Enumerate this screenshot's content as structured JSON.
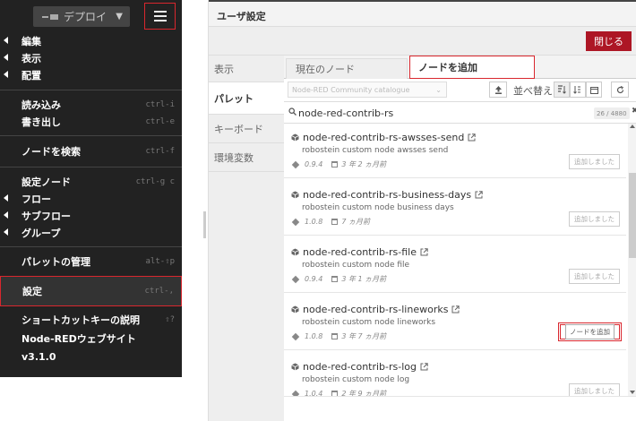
{
  "menu": {
    "deploy_label": "デプロイ",
    "items": [
      {
        "label": "編集",
        "shortcut": "",
        "caret": true
      },
      {
        "label": "表示",
        "shortcut": "",
        "caret": true
      },
      {
        "label": "配置",
        "shortcut": "",
        "caret": true
      },
      {
        "label": "読み込み",
        "shortcut": "ctrl-i",
        "caret": false
      },
      {
        "label": "書き出し",
        "shortcut": "ctrl-e",
        "caret": false
      },
      {
        "label": "ノードを検索",
        "shortcut": "ctrl-f",
        "caret": false
      },
      {
        "label": "設定ノード",
        "shortcut": "ctrl-g c",
        "caret": false
      },
      {
        "label": "フロー",
        "shortcut": "",
        "caret": true
      },
      {
        "label": "サブフロー",
        "shortcut": "",
        "caret": true
      },
      {
        "label": "グループ",
        "shortcut": "",
        "caret": true
      },
      {
        "label": "パレットの管理",
        "shortcut": "alt-⇧p",
        "caret": false
      },
      {
        "label": "設定",
        "shortcut": "ctrl-,",
        "caret": false
      },
      {
        "label": "ショートカットキーの説明",
        "shortcut": "⇧?",
        "caret": false
      },
      {
        "label": "Node-REDウェブサイト",
        "shortcut": "",
        "caret": false
      },
      {
        "label": "v3.1.0",
        "shortcut": "",
        "caret": false
      }
    ]
  },
  "dialog": {
    "title": "ユーザ設定",
    "close_label": "閉じる",
    "side_tabs": [
      "表示",
      "パレット",
      "キーボード",
      "環境変数"
    ],
    "sub_tabs": [
      "現在のノード",
      "ノードを追加"
    ],
    "catalogue": "Node-RED Community catalogue",
    "sort_label": "並べ替え:",
    "search_value": "node-red-contrib-rs",
    "count": "26 / 4880",
    "nodes": [
      {
        "name": "node-red-contrib-rs-awsses-send",
        "desc": "robostein custom node awsses send",
        "version": "0.9.4",
        "updated": "3 年 2 ヵ月前",
        "button": "追加しました",
        "installed": true
      },
      {
        "name": "node-red-contrib-rs-business-days",
        "desc": "robostein custom node business days",
        "version": "1.0.8",
        "updated": "7 ヵ月前",
        "button": "追加しました",
        "installed": true
      },
      {
        "name": "node-red-contrib-rs-file",
        "desc": "robostein custom node file",
        "version": "0.9.4",
        "updated": "3 年 1 ヵ月前",
        "button": "追加しました",
        "installed": true
      },
      {
        "name": "node-red-contrib-rs-lineworks",
        "desc": "robostein custom node lineworks",
        "version": "1.0.8",
        "updated": "3 年 7 ヵ月前",
        "button": "ノードを追加",
        "installed": false
      },
      {
        "name": "node-red-contrib-rs-log",
        "desc": "robostein custom node log",
        "version": "1.0.4",
        "updated": "2 年 9 ヵ月前",
        "button": "追加しました",
        "installed": true
      }
    ]
  },
  "colors": {
    "menu_bg": "#222222",
    "accent_red": "#d9272e",
    "close_btn": "#ad1625"
  }
}
